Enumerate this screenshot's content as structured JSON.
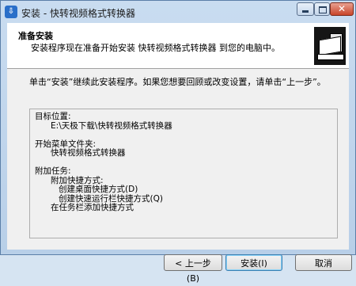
{
  "window": {
    "title": "安装 - 快转视频格式转换器",
    "icon": "installer-icon"
  },
  "header": {
    "title": "准备安装",
    "subtitle": "安装程序现在准备开始安装 快转视频格式转换器 到您的电脑中。"
  },
  "body": {
    "intro": "单击“安装”继续此安装程序。如果您想要回顾或改变设置，请单击“上一步”。",
    "memo": "目标位置:\n      E:\\天极下载\\快转视频格式转换器\n\n开始菜单文件夹:\n      快转视频格式转换器\n\n附加任务:\n      附加快捷方式:\n         创建桌面快捷方式(D)\n         创建快速运行栏快捷方式(Q)\n      在任务栏添加快捷方式"
  },
  "buttons": {
    "back": "< 上一步(B)",
    "install": "安装(I)",
    "cancel": "取消"
  }
}
